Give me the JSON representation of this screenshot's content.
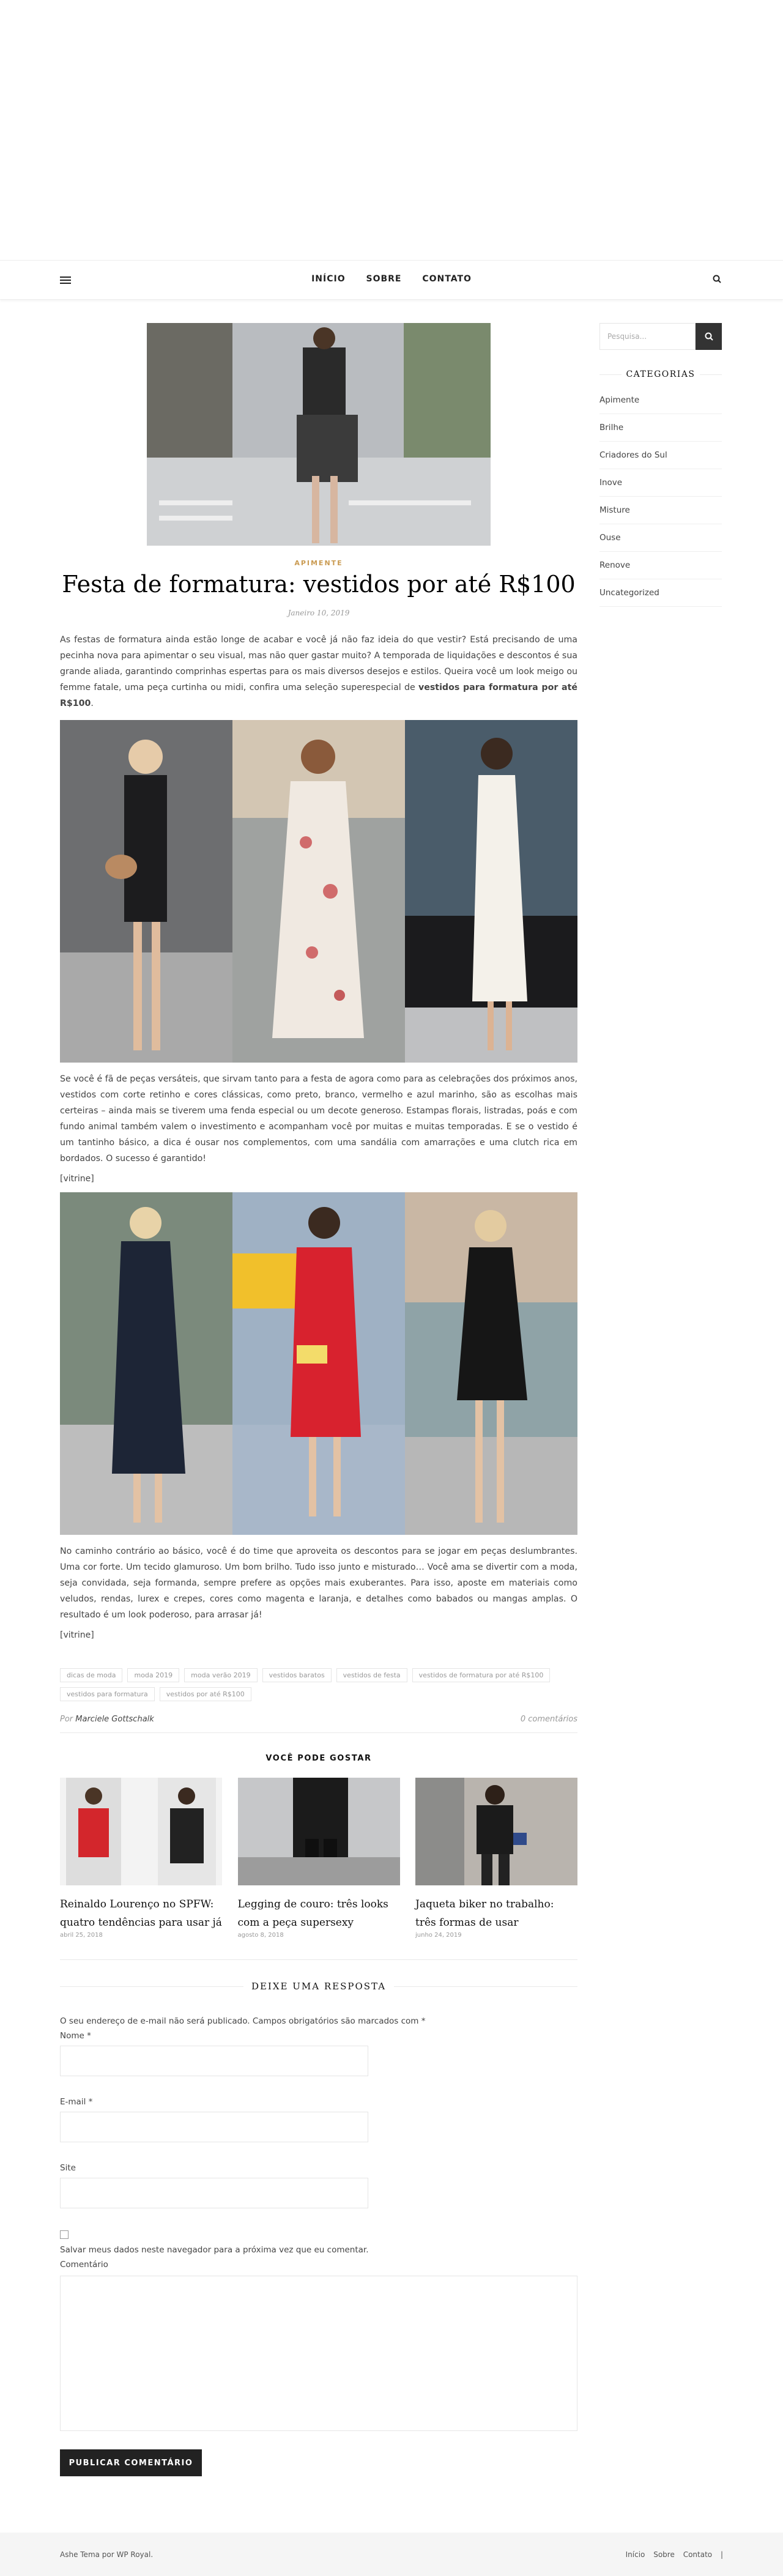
{
  "nav": {
    "items": [
      "INÍCIO",
      "SOBRE",
      "CONTATO"
    ]
  },
  "post": {
    "category": "APIMENTE",
    "title": "Festa de formatura: vestidos por até R$100",
    "date": "Janeiro 10, 2019",
    "p1_text": "As festas de formatura ainda estão longe de acabar e você já não faz ideia do que vestir? Está precisando de uma pecinha nova para apimentar o seu visual, mas não quer gastar muito? A temporada de liquidações e descontos é sua grande aliada, garantindo comprinhas espertas para os mais diversos desejos e estilos. Queira você um look meigo ou femme fatale, uma peça curtinha ou midi, confira uma seleção superespecial de ",
    "p1_bold": "vestidos para formatura por até R$100",
    "p1_end": ".",
    "p2": "Se você é fã de peças versáteis, que sirvam tanto para a festa de agora como para as celebrações dos próximos anos, vestidos com corte retinho e cores clássicas, como preto, branco, vermelho e azul marinho, são as escolhas mais certeiras – ainda mais se tiverem uma fenda especial ou um decote generoso. Estampas florais, listradas, poás e com fundo animal também valem o investimento e acompanham você por muitas e muitas temporadas. E se o vestido é um tantinho básico, a dica é ousar nos complementos, com uma sandália com amarrações e uma clutch rica em bordados. O sucesso é garantido!",
    "vitrine1": "[vitrine]",
    "p3": "No caminho contrário ao básico, você é do time que aproveita os descontos para se jogar em peças deslumbrantes. Uma cor forte. Um tecido glamuroso. Um bom brilho. Tudo isso junto e misturado… Você ama se divertir com a moda, seja convidada, seja formanda, sempre prefere as opções mais exuberantes. Para isso, aposte em materiais como veludos, rendas, lurex e crepes, cores como magenta e laranja, e detalhes como babados ou mangas amplas. O resultado é um look poderoso, para arrasar já!",
    "vitrine2": "[vitrine]",
    "tags": [
      "dicas de moda",
      "moda 2019",
      "moda verão 2019",
      "vestidos baratos",
      "vestidos de festa",
      "vestidos de formatura por até R$100",
      "vestidos para formatura",
      "vestidos por até R$100"
    ],
    "by": "Por",
    "author": "Marciele Gottschalk",
    "comments": "0 comentários"
  },
  "related": {
    "heading": "VOCÊ PODE GOSTAR",
    "items": [
      {
        "title": "Reinaldo Lourenço no SPFW: quatro tendências para usar já",
        "date": "abril 25, 2018"
      },
      {
        "title": "Legging de couro: três looks com a peça supersexy",
        "date": "agosto 8, 2018"
      },
      {
        "title": "Jaqueta biker no trabalho: três formas de usar",
        "date": "junho 24, 2019"
      }
    ]
  },
  "reply": {
    "heading": "DEIXE UMA RESPOSTA",
    "note": "O seu endereço de e-mail não será publicado. Campos obrigatórios são marcados com *",
    "name_label": "Nome *",
    "email_label": "E-mail *",
    "site_label": "Site",
    "save_label": "Salvar meus dados neste navegador para a próxima vez que eu comentar.",
    "comment_label": "Comentário",
    "submit": "PUBLICAR COMENTÁRIO"
  },
  "sidebar": {
    "search_placeholder": "Pesquisa...",
    "cat_heading": "CATEGORIAS",
    "categories": [
      "Apimente",
      "Brilhe",
      "Criadores do Sul",
      "Inove",
      "Misture",
      "Ouse",
      "Renove",
      "Uncategorized"
    ]
  },
  "footer": {
    "credit": "Ashe Tema por WP Royal.",
    "links": [
      "Início",
      "Sobre",
      "Contato",
      "|"
    ]
  },
  "colors": {
    "accent": "#ca9b52",
    "dark": "#222222"
  }
}
